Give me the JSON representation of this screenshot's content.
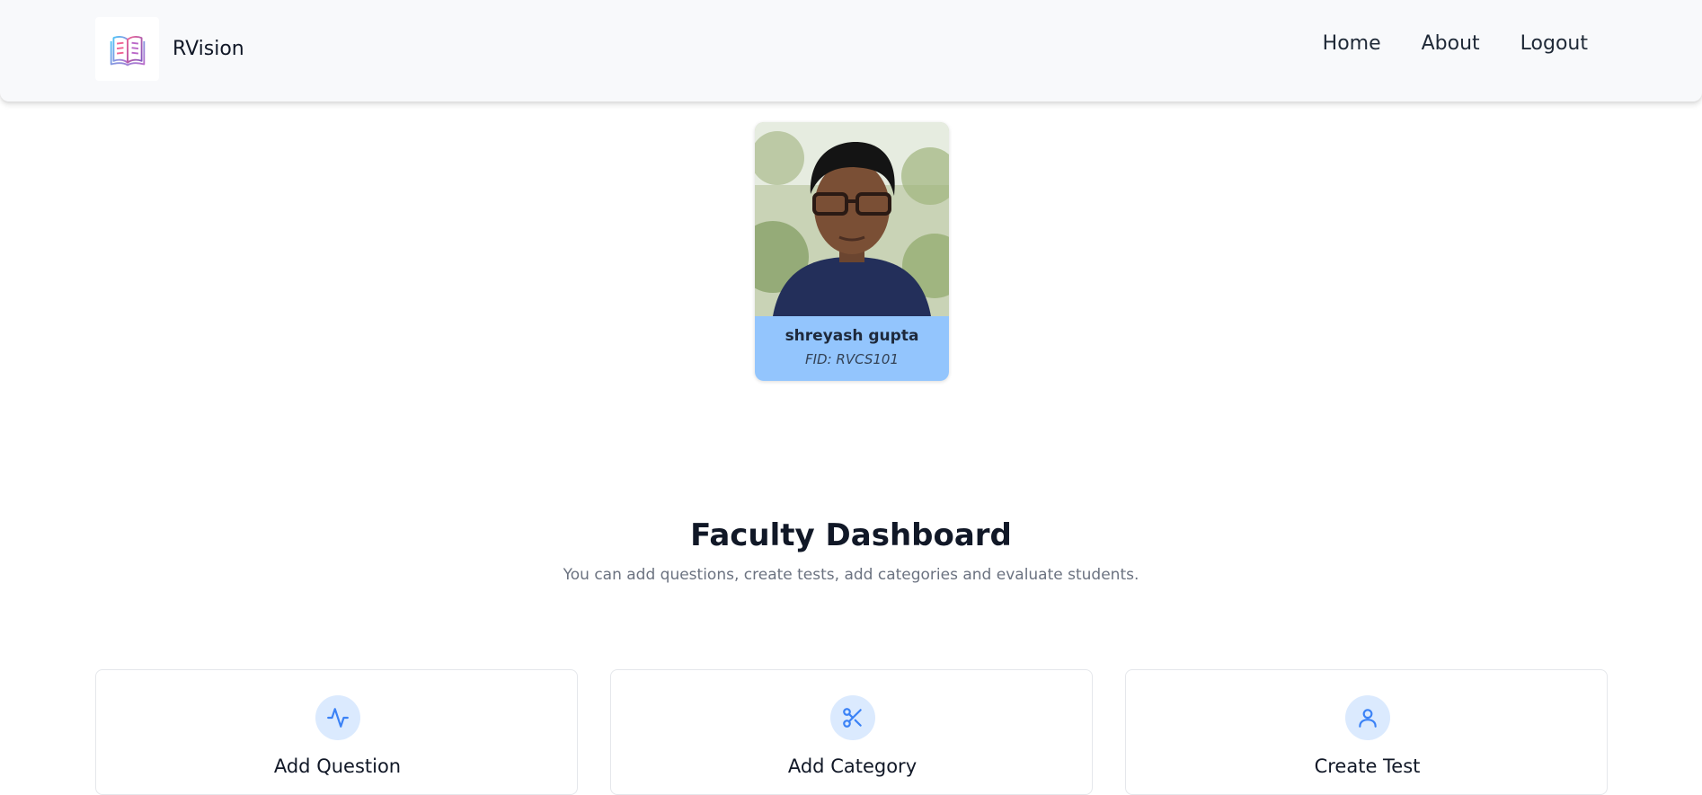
{
  "navbar": {
    "brand": "RVision",
    "logo_icon": "book-icon",
    "links": [
      "Home",
      "About",
      "Logout"
    ]
  },
  "profile": {
    "name": "shreyash gupta",
    "fid": "FID: RVCS101",
    "photo_alt": "profile-photo"
  },
  "dashboard": {
    "title": "Faculty Dashboard",
    "subtitle": "You can add questions, create tests, add categories and evaluate students."
  },
  "cards": [
    {
      "title": "Add Question",
      "icon": "activity-icon"
    },
    {
      "title": "Add Category",
      "icon": "scissors-icon"
    },
    {
      "title": "Create Test",
      "icon": "user-icon"
    }
  ],
  "colors": {
    "accent": "#3b82f6",
    "profile_band": "#93c5fd",
    "icon_bg": "#dbeafe"
  }
}
